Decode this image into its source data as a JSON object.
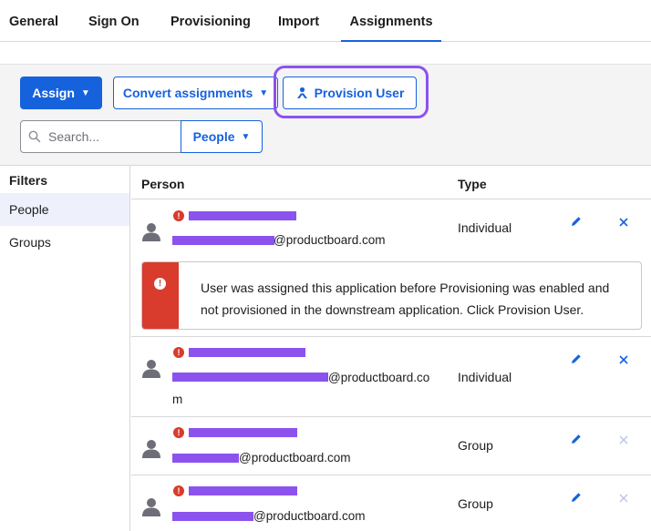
{
  "tabs": [
    {
      "label": "General"
    },
    {
      "label": "Sign On"
    },
    {
      "label": "Provisioning"
    },
    {
      "label": "Import"
    },
    {
      "label": "Assignments",
      "active": true
    }
  ],
  "toolbar": {
    "assign_label": "Assign",
    "convert_label": "Convert assignments",
    "provision_label": "Provision User",
    "search_placeholder": "Search...",
    "people_filter_label": "People"
  },
  "filters": {
    "title": "Filters",
    "items": [
      "People",
      "Groups"
    ]
  },
  "table": {
    "headers": {
      "person": "Person",
      "type": "Type"
    },
    "rows": [
      {
        "email_domain": "@productboard.com",
        "type": "Individual",
        "error": true
      },
      {
        "email_domain_line1": "@productboard.co",
        "email_domain_line2": "m",
        "type": "Individual",
        "error": true
      },
      {
        "email_domain": "@productboard.com",
        "type": "Group",
        "error": true
      },
      {
        "email_domain": "@productboard.com",
        "type": "Group",
        "error": true
      }
    ]
  },
  "alert": {
    "message": "User was assigned this application before Provisioning was enabled and not provisioned in the downstream application. Click Provision User."
  },
  "colors": {
    "accent": "#1662dd",
    "error": "#d93b2d",
    "highlight": "#8c52ee",
    "redaction": "#8c52ee"
  }
}
